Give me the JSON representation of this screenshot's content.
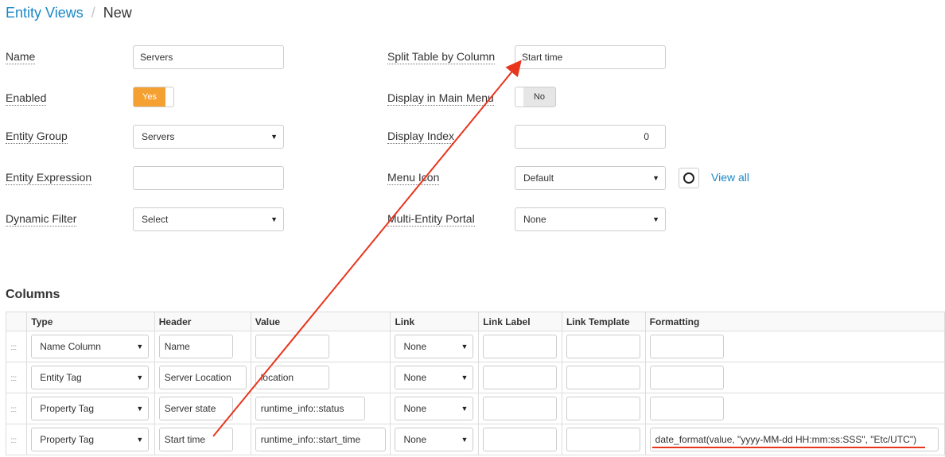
{
  "breadcrumb": {
    "parent": "Entity Views",
    "separator": "/",
    "current": "New"
  },
  "form": {
    "name": {
      "label": "Name",
      "value": "Servers"
    },
    "enabled": {
      "label": "Enabled",
      "value": "Yes"
    },
    "entity_group": {
      "label": "Entity Group",
      "value": "Servers"
    },
    "entity_expression": {
      "label": "Entity Expression",
      "value": ""
    },
    "dynamic_filter": {
      "label": "Dynamic Filter",
      "value": "Select"
    },
    "split_table": {
      "label": "Split Table by Column",
      "value": "Start time"
    },
    "display_main_menu": {
      "label": "Display in Main Menu",
      "value": "No"
    },
    "display_index": {
      "label": "Display Index",
      "value": "0"
    },
    "menu_icon": {
      "label": "Menu Icon",
      "value": "Default",
      "view_all": "View all"
    },
    "multi_entity_portal": {
      "label": "Multi-Entity Portal",
      "value": "None"
    }
  },
  "columns": {
    "title": "Columns",
    "headers": [
      "Type",
      "Header",
      "Value",
      "Link",
      "Link Label",
      "Link Template",
      "Formatting"
    ],
    "rows": [
      {
        "type": "Name Column",
        "header": "Name",
        "value": "",
        "link": "None",
        "link_label": "",
        "link_template": "",
        "formatting": ""
      },
      {
        "type": "Entity Tag",
        "header": "Server Location",
        "value": "location",
        "link": "None",
        "link_label": "",
        "link_template": "",
        "formatting": ""
      },
      {
        "type": "Property Tag",
        "header": "Server state",
        "value": "runtime_info::status",
        "link": "None",
        "link_label": "",
        "link_template": "",
        "formatting": ""
      },
      {
        "type": "Property Tag",
        "header": "Start time",
        "value": "runtime_info::start_time",
        "link": "None",
        "link_label": "",
        "link_template": "",
        "formatting": "date_format(value, \"yyyy-MM-dd HH:mm:ss:SSS\", \"Etc/UTC\")"
      }
    ]
  },
  "colors": {
    "accent": "#1a87c7",
    "toggle_on": "#f5a033",
    "annotation": "#e8361e"
  }
}
